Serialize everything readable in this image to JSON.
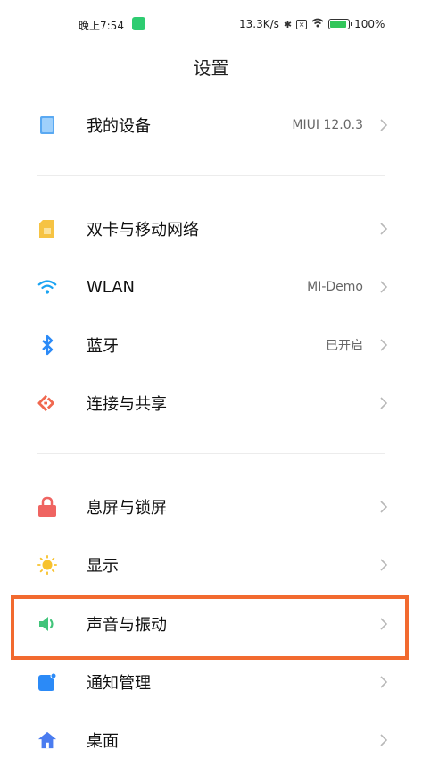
{
  "status_bar": {
    "time": "晚上7:54",
    "net_speed": "13.3K/s",
    "battery": "100%"
  },
  "title": "设置",
  "sections": [
    {
      "items": [
        {
          "label": "我的设备",
          "value": "MIUI 12.0.3",
          "icon": "phone-device-icon",
          "color": "#5aa9f2"
        }
      ]
    },
    {
      "items": [
        {
          "label": "双卡与移动网络",
          "value": "",
          "icon": "sim-card-icon",
          "color": "#f6c343"
        },
        {
          "label": "WLAN",
          "value": "MI-Demo",
          "icon": "wifi-icon",
          "color": "#1aa3f2"
        },
        {
          "label": "蓝牙",
          "value": "已开启",
          "icon": "bluetooth-icon",
          "color": "#2b8af7"
        },
        {
          "label": "连接与共享",
          "value": "",
          "icon": "connection-share-icon",
          "color": "#f0684f"
        }
      ]
    },
    {
      "items": [
        {
          "label": "息屏与锁屏",
          "value": "",
          "icon": "lock-icon",
          "color": "#ef6461"
        },
        {
          "label": "显示",
          "value": "",
          "icon": "sun-icon",
          "color": "#f7c22e"
        },
        {
          "label": "声音与振动",
          "value": "",
          "icon": "speaker-icon",
          "color": "#41c47a"
        },
        {
          "label": "通知管理",
          "value": "",
          "icon": "notification-icon",
          "color": "#2b8af7"
        },
        {
          "label": "桌面",
          "value": "",
          "icon": "home-icon",
          "color": "#4a7cf0"
        }
      ]
    }
  ],
  "highlight_color": "#f26a2f"
}
